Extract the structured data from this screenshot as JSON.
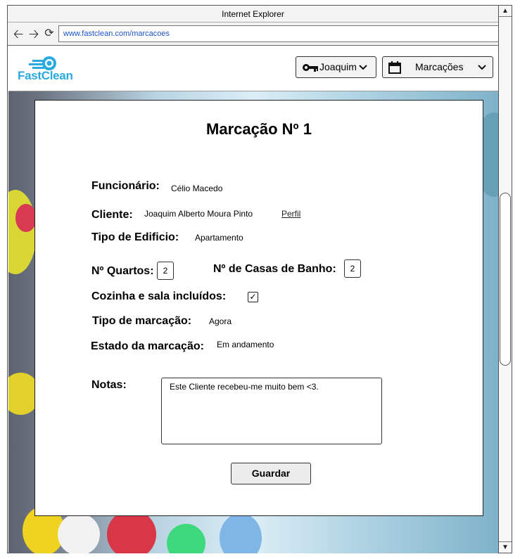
{
  "browser": {
    "title": "Internet Explorer",
    "url": "www.fastclean.com/marcacoes"
  },
  "header": {
    "logo_text": "FastClean",
    "user_label": "Joaquim",
    "menu_label": "Marcações",
    "brand_color": "#2baae0"
  },
  "booking": {
    "title": "Marcação Nº 1",
    "employee_label": "Funcionário:",
    "employee_value": "Célio Macedo",
    "client_label": "Cliente:",
    "client_value": "Joaquim Alberto Moura Pinto",
    "profile_link": "Perfil",
    "building_label": "Tipo de Edificio:",
    "building_value": "Apartamento",
    "rooms_label": "Nº Quartos:",
    "rooms_value": "2",
    "bathrooms_label": "Nº de Casas de Banho:",
    "bathrooms_value": "2",
    "kitchen_label": "Cozinha e sala incluídos:",
    "kitchen_checked": "✓",
    "type_label": "Tipo de marcação:",
    "type_value": "Agora",
    "status_label": "Estado da marcação:",
    "status_value": "Em andamento",
    "notes_label": "Notas:",
    "notes_value": "Este Cliente recebeu-me muito bem <3.",
    "save_label": "Guardar"
  }
}
